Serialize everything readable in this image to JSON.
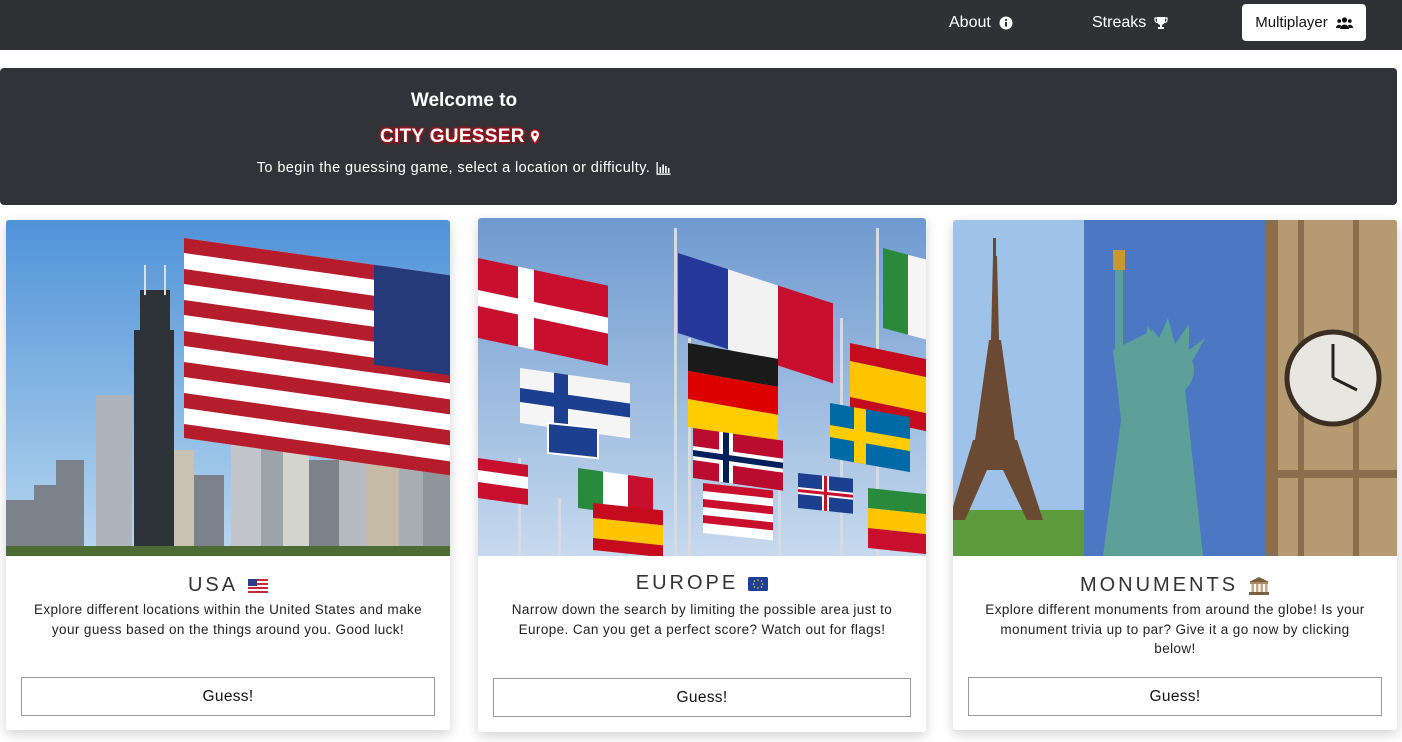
{
  "nav": {
    "about_label": "About",
    "streaks_label": "Streaks",
    "multiplayer_label": "Multiplayer"
  },
  "hero": {
    "welcome": "Welcome to",
    "brand": "CITY GUESSER",
    "subtitle": "To begin the guessing game, select a location or difficulty."
  },
  "cards": [
    {
      "title": "USA",
      "description": "Explore different locations within the United States and make your guess based on the things around you. Good luck!",
      "button": "Guess!"
    },
    {
      "title": "EUROPE",
      "description": "Narrow down the search by limiting the possible area just to Europe. Can you get a perfect score? Watch out for flags!",
      "button": "Guess!"
    },
    {
      "title": "MONUMENTS",
      "description": "Explore different monuments from around the globe! Is your monument trivia up to par? Give it a go now by clicking below!",
      "button": "Guess!"
    }
  ],
  "colors": {
    "navbar_bg": "#2f3135",
    "hero_bg": "#313338",
    "brand_glow": "#b01018"
  },
  "icons": {
    "about": "info-circle-icon",
    "streaks": "trophy-icon",
    "multiplayer": "users-icon",
    "brand": "map-marker-icon",
    "subtitle": "bar-chart-icon",
    "usa": "us-flag-icon",
    "europe": "eu-flag-icon",
    "monuments": "classical-building-icon"
  }
}
